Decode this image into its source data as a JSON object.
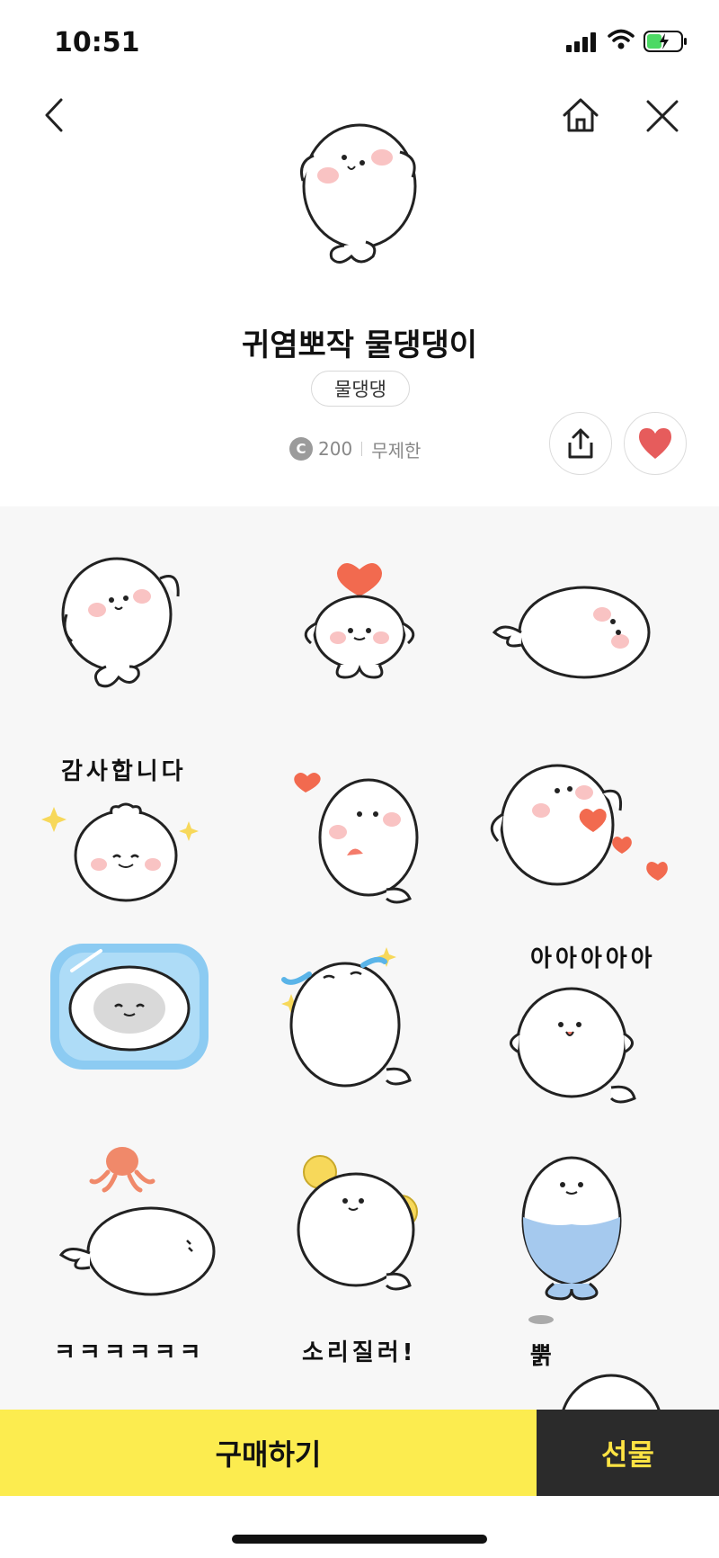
{
  "status": {
    "time": "10:51"
  },
  "product": {
    "title": "귀염뽀작 물댕댕이",
    "author": "물댕댕",
    "currency_symbol": "C",
    "price": "200",
    "period": "무제한"
  },
  "stickers": [
    {
      "name": "seal-wave",
      "caption": ""
    },
    {
      "name": "seal-heart-head",
      "caption": ""
    },
    {
      "name": "seal-lying",
      "caption": ""
    },
    {
      "name": "seal-thanks",
      "caption": "감사합니다"
    },
    {
      "name": "seal-hearts-kiss",
      "caption": ""
    },
    {
      "name": "seal-hearts-love",
      "caption": ""
    },
    {
      "name": "seal-window",
      "caption": ""
    },
    {
      "name": "seal-tears",
      "caption": ""
    },
    {
      "name": "seal-aaaa",
      "caption": "아아아아아"
    },
    {
      "name": "seal-octopus",
      "caption": ""
    },
    {
      "name": "seal-pompom",
      "caption": ""
    },
    {
      "name": "seal-water",
      "caption": ""
    },
    {
      "name": "seal-kkk",
      "caption": "ㅋㅋㅋㅋㅋㅋ"
    },
    {
      "name": "seal-shout",
      "caption": "소리질러!"
    },
    {
      "name": "seal-ppyak",
      "caption": "뿕"
    }
  ],
  "actions": {
    "buy_label": "구매하기",
    "gift_label": "선물"
  },
  "colors": {
    "buy_bg": "#fcec4f",
    "gift_bg": "#2b2b2b",
    "gift_text": "#fde343",
    "heart": "#e65c5c"
  },
  "icons": [
    "back-icon",
    "home-icon",
    "close-icon",
    "share-icon",
    "heart-icon",
    "signal-icon",
    "wifi-icon",
    "battery-icon"
  ]
}
